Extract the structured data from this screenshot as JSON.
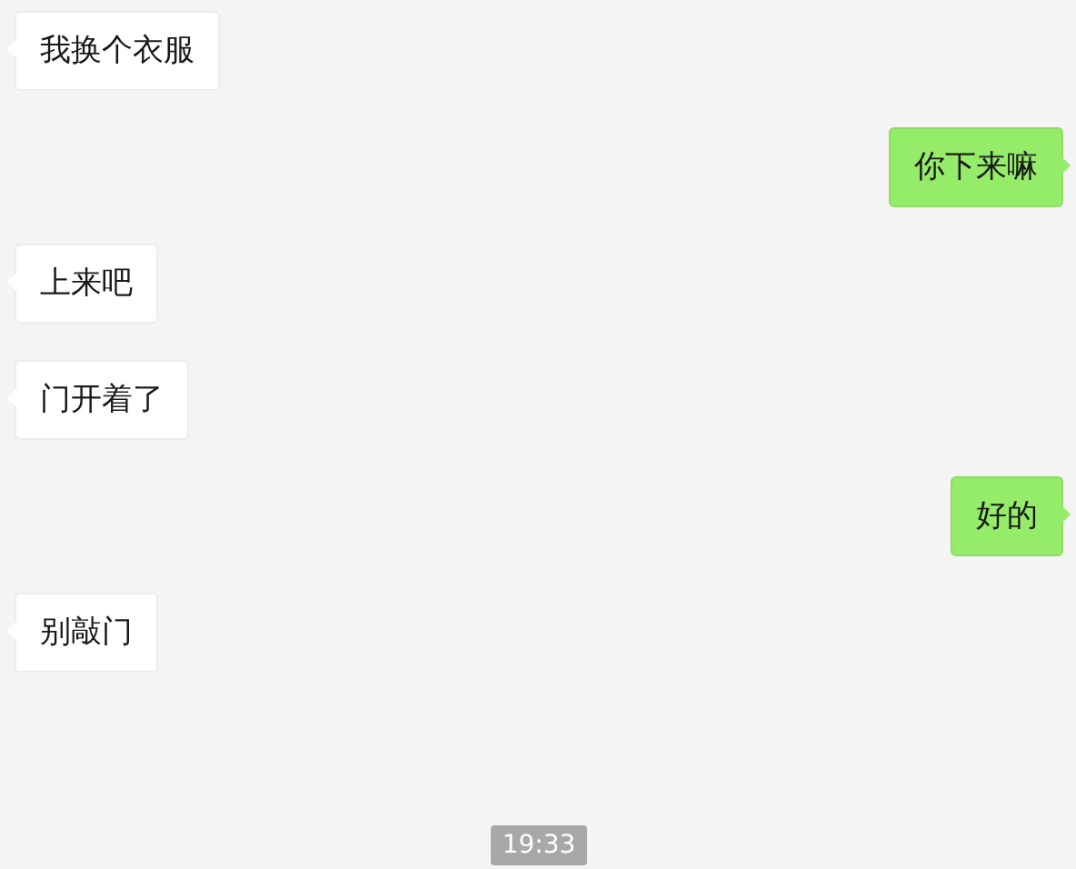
{
  "messages": [
    {
      "kind": "received",
      "text": "我换个衣服"
    },
    {
      "kind": "sent",
      "text": "你下来嘛"
    },
    {
      "kind": "received",
      "text": "上来吧"
    },
    {
      "kind": "received",
      "text": "门开着了"
    },
    {
      "kind": "sent",
      "text": "好的"
    },
    {
      "kind": "received",
      "text": "别敲门"
    }
  ],
  "timestamp": "19:33"
}
